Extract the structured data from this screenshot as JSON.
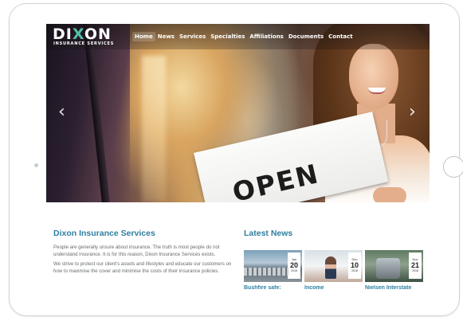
{
  "brand": {
    "name_before_x": "DI",
    "name_x": "X",
    "name_after_x": "ON",
    "tagline": "INSURANCE SERVICES",
    "accent_color": "#4fc0a6",
    "heading_color": "#2e7fa0"
  },
  "nav": {
    "items": [
      {
        "label": "Home",
        "active": true
      },
      {
        "label": "News",
        "active": false
      },
      {
        "label": "Services",
        "active": false
      },
      {
        "label": "Specialties",
        "active": false
      },
      {
        "label": "Affiliations",
        "active": false
      },
      {
        "label": "Documents",
        "active": false
      },
      {
        "label": "Contact",
        "active": false
      }
    ]
  },
  "hero": {
    "sign_text": "OPEN",
    "prev_icon": "chevron-left-icon",
    "next_icon": "chevron-right-icon",
    "prev_glyph": "‹",
    "next_glyph": "›"
  },
  "about": {
    "title": "Dixon Insurance Services",
    "paragraphs": [
      "People are generally unsure about insurance. The truth is most people do not understand insurance. It is for this reason, Dixon Insurance Services exists.",
      "We strive to protect our client's assets and lifestyles and educate our customers on how to maximise the cover and minimise the costs of their insurance policies."
    ]
  },
  "news": {
    "title": "Latest News",
    "cards": [
      {
        "month": "Jan",
        "day": "20",
        "year": "2018",
        "title": "Bushfire safe:"
      },
      {
        "month": "Dec",
        "day": "10",
        "year": "2018",
        "title": "Income"
      },
      {
        "month": "Nov",
        "day": "21",
        "year": "2018",
        "title": "Nielsen Interstate"
      }
    ]
  }
}
